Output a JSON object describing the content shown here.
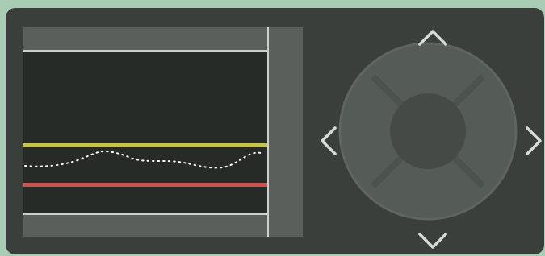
{
  "device": {
    "colors": {
      "background": "#a9cdb4",
      "body": "#3a3f3b",
      "screen_frame": "#5a5f5b",
      "screen": "#262b27",
      "upper_limit_line": "#c8c24a",
      "lower_limit_line": "#c9544f",
      "trace": "#ffffff",
      "dpad": "#555b57",
      "dpad_center": "#454a46",
      "arrow": "#d8dcd9"
    }
  },
  "dpad": {
    "icons": {
      "up": "chevron-up-icon",
      "down": "chevron-down-icon",
      "left": "chevron-left-icon",
      "right": "chevron-right-icon"
    }
  }
}
